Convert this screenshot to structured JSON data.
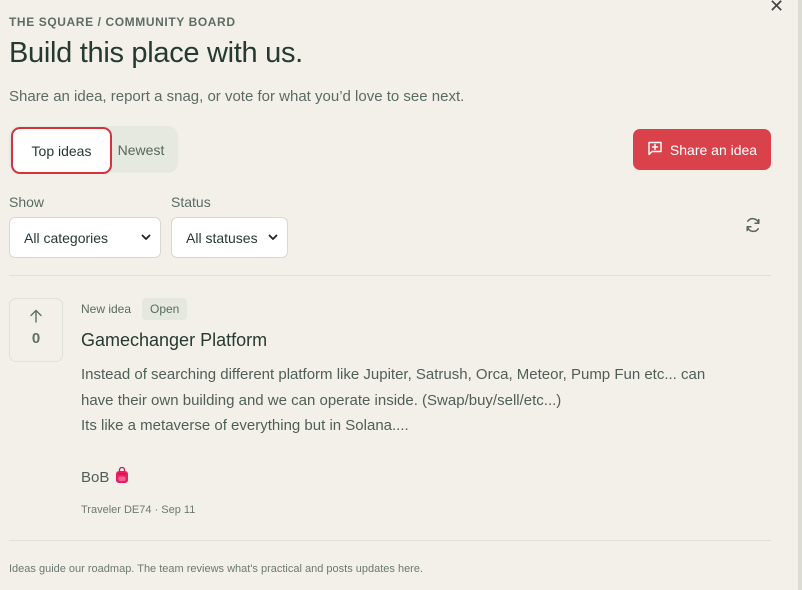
{
  "header": {
    "eyebrow": "THE SQUARE / COMMUNITY BOARD",
    "title": "Build this place with us.",
    "subtitle": "Share an idea, report a snag, or vote for what you’d love to see next.",
    "close_icon": "close-icon"
  },
  "sort_tabs": [
    {
      "label": "Top ideas",
      "active": true
    },
    {
      "label": "Newest",
      "active": false
    }
  ],
  "share_button": {
    "label": "Share an idea",
    "icon": "plus-square-icon",
    "color": "#d9424a"
  },
  "filters": {
    "show": {
      "label": "Show",
      "value": "All categories"
    },
    "status": {
      "label": "Status",
      "value": "All statuses"
    },
    "refresh_icon": "refresh-icon"
  },
  "ideas": [
    {
      "votes": "0",
      "tag": "New idea",
      "status": "Open",
      "title": "Gamechanger Platform",
      "body_lines": [
        "Instead of searching different platform like Jupiter, Satrush, Orca, Meteor, Pump Fun etc... can",
        "have their own building and we can operate inside. (Swap/buy/sell/etc...)",
        "Its like a metaverse of everything but in Solana...."
      ],
      "signature": "BoB",
      "signature_icon": "backpack-emoji",
      "author": "Traveler DE74 · Sep 11"
    }
  ],
  "footer": "Ideas guide our roadmap. The team reviews what's practical and posts updates here.",
  "colors": {
    "accent": "#d9424a",
    "background": "#f3f0e9",
    "text": "#253a30"
  }
}
